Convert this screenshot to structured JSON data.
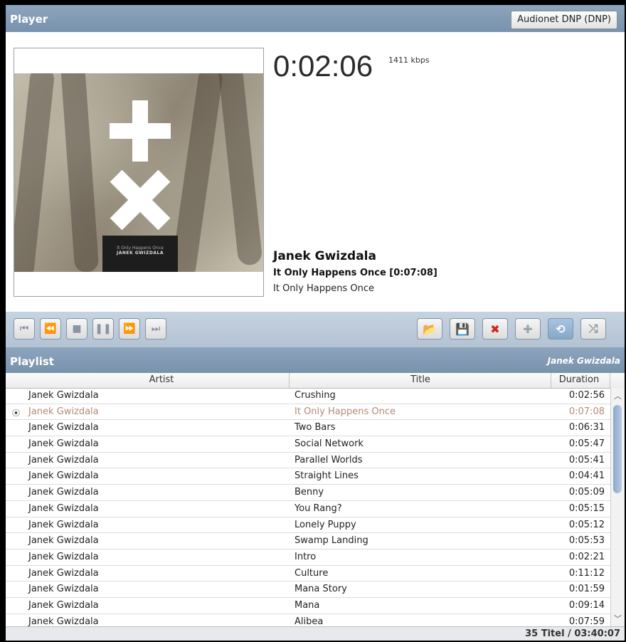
{
  "player": {
    "header": "Player",
    "device": "Audionet DNP (DNP)",
    "time": "0:02:06",
    "bitrate": "1411 kbps",
    "now_playing": {
      "artist": "Janek Gwizdala",
      "title": "It Only Happens Once [0:07:08]",
      "album": "It Only Happens Once"
    },
    "cover_text": {
      "small": "It Only Happens Once",
      "big": "JANEK GWIZDALA"
    }
  },
  "controls": {
    "transport": [
      {
        "name": "skip-back-button",
        "glyph": "⏮"
      },
      {
        "name": "rewind-button",
        "glyph": "⏪"
      },
      {
        "name": "stop-button",
        "glyph": "■"
      },
      {
        "name": "pause-button",
        "glyph": "❚❚"
      },
      {
        "name": "fast-forward-button",
        "glyph": "⏩"
      },
      {
        "name": "skip-forward-button",
        "glyph": "⏭"
      }
    ],
    "playlist_tools": [
      {
        "name": "open-playlist-button",
        "icon": "folder-icon",
        "glyph": "📂",
        "color": "#e6a93b"
      },
      {
        "name": "save-playlist-button",
        "icon": "save-icon",
        "glyph": "💾",
        "color": "#4a5668"
      },
      {
        "name": "delete-button",
        "icon": "delete-icon",
        "glyph": "✖",
        "color": "#d42121"
      },
      {
        "name": "add-button",
        "icon": "plus-icon",
        "glyph": "✚",
        "color": "#9aa3ad"
      },
      {
        "name": "repeat-button",
        "icon": "repeat-icon",
        "glyph": "⟲",
        "color": "#ffffff",
        "toggled": true
      },
      {
        "name": "shuffle-button",
        "icon": "shuffle-icon",
        "glyph": "⤮",
        "color": "#8b96a2"
      }
    ]
  },
  "playlist": {
    "header": "Playlist",
    "artist": "Janek Gwizdala",
    "columns": {
      "artist": "Artist",
      "title": "Title",
      "duration": "Duration"
    },
    "rows": [
      {
        "artist": "Janek Gwizdala",
        "title": "Crushing",
        "duration": "0:02:56"
      },
      {
        "artist": "Janek Gwizdala",
        "title": "It Only Happens Once",
        "duration": "0:07:08",
        "playing": true
      },
      {
        "artist": "Janek Gwizdala",
        "title": "Two Bars",
        "duration": "0:06:31"
      },
      {
        "artist": "Janek Gwizdala",
        "title": "Social Network",
        "duration": "0:05:47"
      },
      {
        "artist": "Janek Gwizdala",
        "title": "Parallel Worlds",
        "duration": "0:05:41"
      },
      {
        "artist": "Janek Gwizdala",
        "title": "Straight Lines",
        "duration": "0:04:41"
      },
      {
        "artist": "Janek Gwizdala",
        "title": "Benny",
        "duration": "0:05:09"
      },
      {
        "artist": "Janek Gwizdala",
        "title": "You Rang?",
        "duration": "0:05:15"
      },
      {
        "artist": "Janek Gwizdala",
        "title": "Lonely Puppy",
        "duration": "0:05:12"
      },
      {
        "artist": "Janek Gwizdala",
        "title": "Swamp Landing",
        "duration": "0:05:53"
      },
      {
        "artist": "Janek Gwizdala",
        "title": "Intro",
        "duration": "0:02:21"
      },
      {
        "artist": "Janek Gwizdala",
        "title": "Culture",
        "duration": "0:11:12"
      },
      {
        "artist": "Janek Gwizdala",
        "title": "Mana Story",
        "duration": "0:01:59"
      },
      {
        "artist": "Janek Gwizdala",
        "title": "Mana",
        "duration": "0:09:14"
      },
      {
        "artist": "Janek Gwizdala",
        "title": "Alibea",
        "duration": "0:07:59"
      }
    ],
    "summary": "35 Titel / 03:40:07"
  }
}
